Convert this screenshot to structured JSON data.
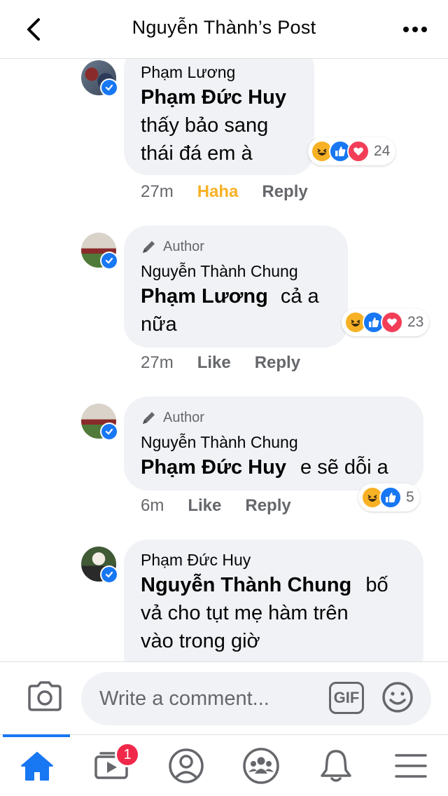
{
  "header": {
    "title": "Nguyễn Thành’s Post"
  },
  "comments": [
    {
      "name": "Phạm Lương",
      "author_badge": "",
      "mention": "Phạm Đức Huy",
      "text_lines": [
        "thấy bảo sang",
        "thái đá em à"
      ],
      "time": "27m",
      "reaction_action": "Haha",
      "reply": "Reply",
      "reactions": [
        "haha-icon",
        "like-icon",
        "love-icon"
      ],
      "reaction_count": "24"
    },
    {
      "author_badge": "Author",
      "name": "Nguyễn Thành Chung",
      "mention": "Phạm Lương",
      "text_lines": [
        "cả a",
        "nữa"
      ],
      "time": "27m",
      "reaction_action": "Like",
      "reply": "Reply",
      "reactions": [
        "haha-icon",
        "like-icon",
        "love-icon"
      ],
      "reaction_count": "23"
    },
    {
      "author_badge": "Author",
      "name": "Nguyễn Thành Chung",
      "mention": "Phạm Đức Huy",
      "text_lines": [
        "e sẽ dỗi a"
      ],
      "time": "6m",
      "reaction_action": "Like",
      "reply": "Reply",
      "reactions": [
        "haha-icon",
        "like-icon"
      ],
      "reaction_count": "5"
    },
    {
      "name": "Phạm Đức Huy",
      "mention": "Nguyễn Thành Chung",
      "text_lines": [
        "bố",
        "vả cho tụt mẹ hàm trên",
        "vào trong giờ"
      ]
    }
  ],
  "composer": {
    "placeholder": "Write a comment...",
    "gif_label": "GIF"
  },
  "tabbar": {
    "tabs": [
      "home-icon",
      "watch-icon",
      "profile-icon",
      "groups-icon",
      "notifications-icon",
      "menu-icon"
    ],
    "watch_badge": "1"
  },
  "colors": {
    "accent": "#1877f2",
    "haha": "#f7b125",
    "love": "#f33e58",
    "badge": "#f02849",
    "bubble": "#f0f2f5",
    "secondary_text": "#65676b"
  }
}
